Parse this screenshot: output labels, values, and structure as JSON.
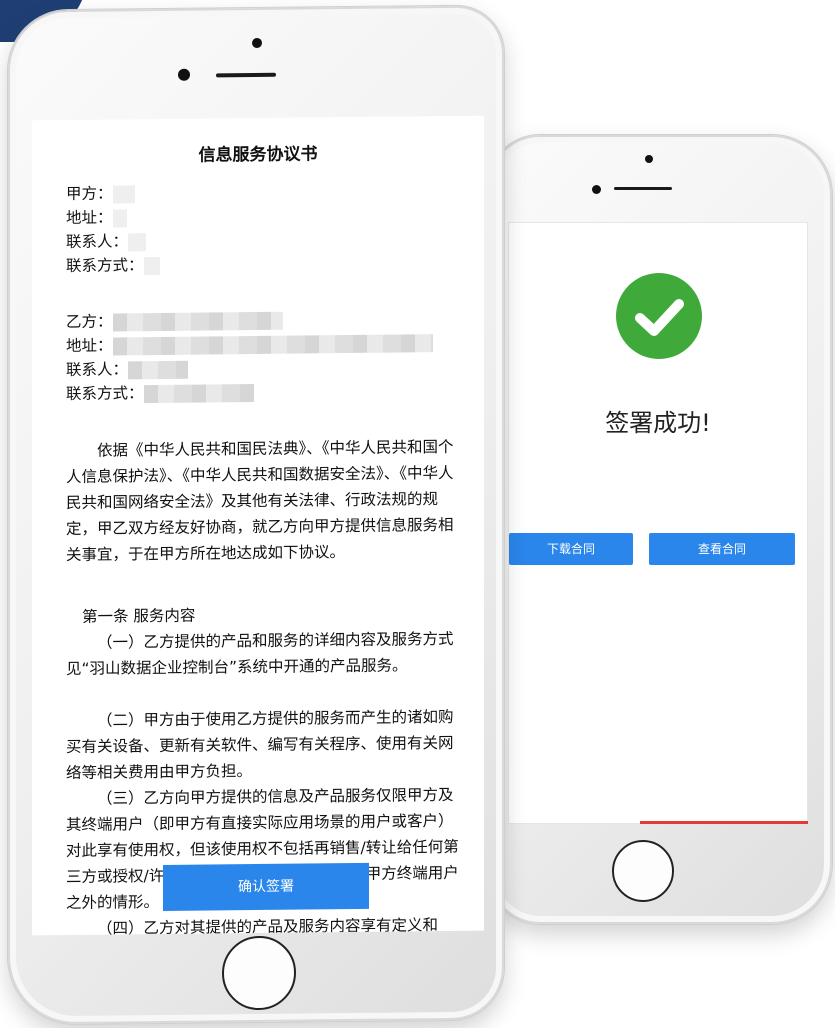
{
  "contract": {
    "title": "信息服务协议书",
    "party_a": {
      "label": "甲方：",
      "address_label": "地址：",
      "contact_label": "联系人：",
      "phone_label": "联系方式："
    },
    "party_b": {
      "label": "乙方：",
      "address_label": "地址：",
      "contact_label": "联系人：",
      "phone_label": "联系方式："
    },
    "intro": "依据《中华人民共和国民法典》、《中华人民共和国个人信息保护法》、《中华人民共和国数据安全法》、《中华人民共和国网络安全法》及其他有关法律、行政法规的规定，甲乙双方经友好协商，就乙方向甲方提供信息服务相关事宜，于在甲方所在地达成如下协议。",
    "section1_heading": "第一条 服务内容",
    "clause1": "（一）乙方提供的产品和服务的详细内容及服务方式见“羽山数据企业控制台”系统中开通的产品服务。",
    "clause2": "（二）甲方由于使用乙方提供的服务而产生的诸如购买有关设备、更新有关软件、编写有关程序、使用有关网络等相关费用由甲方负担。",
    "clause3": "（三）乙方向甲方提供的信息及产品服务仅限甲方及其终端用户（即甲方有直接实际应用场景的用户或客户）对此享有使用权，但该使用权不包括再销售/转让给任何第三方或授权/许可任何第三方使用等除甲方及甲方终端用户之外的情形。",
    "clause4": "（四）乙方对其提供的产品及服务内容享有定义和",
    "confirm_button": "确认签署"
  },
  "success": {
    "message": "签署成功!",
    "download_button": "下载合同",
    "view_button": "查看合同"
  },
  "colors": {
    "primary_blue": "#2a86eb",
    "success_green": "#3fa93a",
    "corner_navy": "#1f3f74",
    "accent_red": "#e53935"
  },
  "icons": {
    "success": "check-circle-icon"
  }
}
